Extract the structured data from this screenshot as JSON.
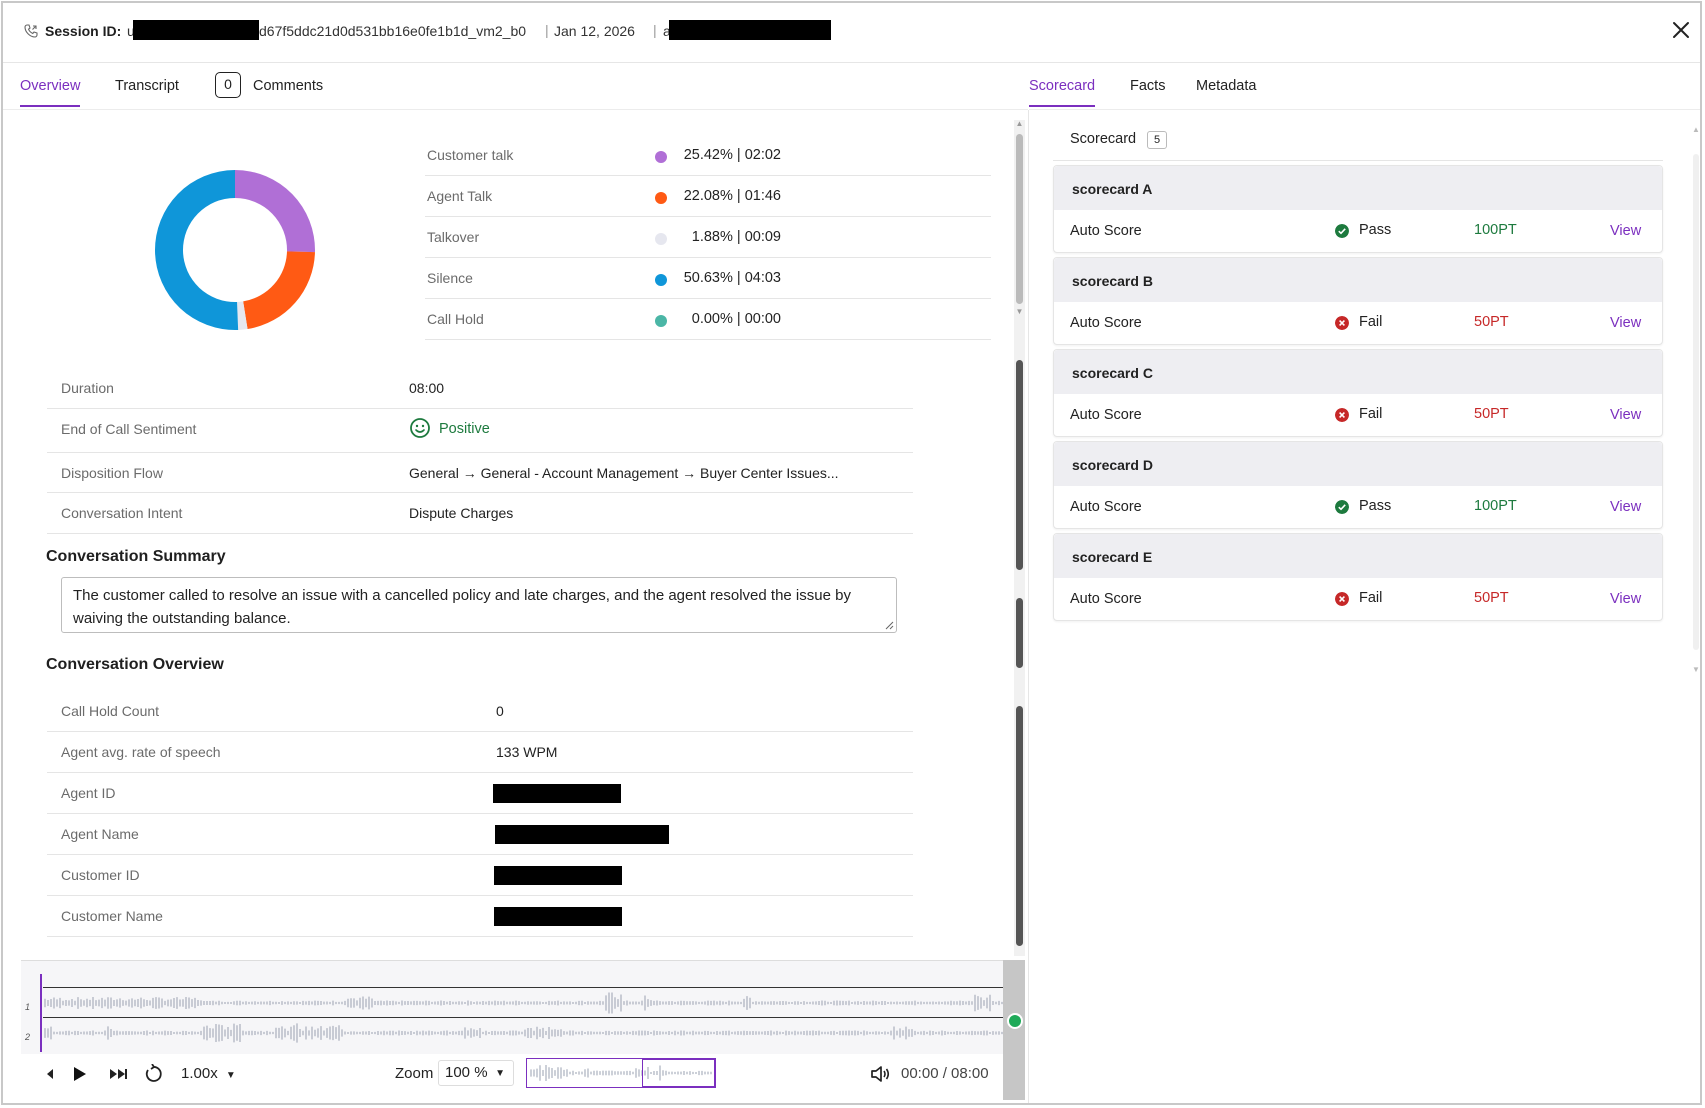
{
  "header": {
    "session_label": "Session ID:",
    "session_prefix": "u",
    "session_id_tail": "d67f5ddc21d0d531bb16e0fe1b1d_vm2_b0",
    "date": "Jan 12, 2026",
    "user_prefix": "a",
    "separator": "|"
  },
  "left_tabs": {
    "overview": "Overview",
    "transcript": "Transcript",
    "comments_count": "0",
    "comments": "Comments"
  },
  "right_tabs": {
    "scorecard": "Scorecard",
    "facts": "Facts",
    "metadata": "Metadata"
  },
  "talk_breakdown": {
    "items": [
      {
        "label": "Customer talk",
        "value": "25.42% | 02:02",
        "color": "#b06fd6",
        "percent": 25.42
      },
      {
        "label": "Agent Talk",
        "value": "22.08% | 01:46",
        "color": "#ff5a14",
        "percent": 22.08
      },
      {
        "label": "Talkover",
        "value": "1.88% | 00:09",
        "color": "#e6e7ef",
        "percent": 1.88
      },
      {
        "label": "Silence",
        "value": "50.63% | 04:03",
        "color": "#0f96d9",
        "percent": 50.63
      },
      {
        "label": "Call Hold",
        "value": "0.00% | 00:00",
        "color": "#4bb6a6",
        "percent": 0.0
      }
    ]
  },
  "call_info": {
    "duration_label": "Duration",
    "duration": "08:00",
    "sentiment_label": "End of Call Sentiment",
    "sentiment": "Positive",
    "disposition_label": "Disposition Flow",
    "disposition": "General → General - Account Management → Buyer Center Issues...",
    "intent_label": "Conversation Intent",
    "intent": "Dispute Charges"
  },
  "summary": {
    "title": "Conversation Summary",
    "text": "The customer called to resolve an issue with a cancelled policy and late charges, and the agent resolved the issue by waiving the outstanding balance."
  },
  "overview": {
    "title": "Conversation Overview",
    "hold_count_label": "Call Hold Count",
    "hold_count": "0",
    "rate_label": "Agent avg. rate of speech",
    "rate": "133 WPM",
    "agent_id_label": "Agent ID",
    "agent_name_label": "Agent Name",
    "customer_id_label": "Customer ID",
    "customer_name_label": "Customer Name"
  },
  "player": {
    "track1": "1",
    "track2": "2",
    "speed": "1.00x",
    "zoom_label": "Zoom",
    "zoom_value": "100 %",
    "time": "00:00 / 08:00"
  },
  "scorecard": {
    "title": "Scorecard",
    "count": "5",
    "cards": [
      {
        "title": "scorecard A",
        "type": "Auto Score",
        "status": "Pass",
        "points": "100PT",
        "view": "View"
      },
      {
        "title": "scorecard B",
        "type": "Auto Score",
        "status": "Fail",
        "points": "50PT",
        "view": "View"
      },
      {
        "title": "scorecard C",
        "type": "Auto Score",
        "status": "Fail",
        "points": "50PT",
        "view": "View"
      },
      {
        "title": "scorecard D",
        "type": "Auto Score",
        "status": "Pass",
        "points": "100PT",
        "view": "View"
      },
      {
        "title": "scorecard E",
        "type": "Auto Score",
        "status": "Fail",
        "points": "50PT",
        "view": "View"
      }
    ]
  },
  "colors": {
    "accent": "#7b2fbf",
    "pass": "#1d7a3e",
    "fail": "#c62828"
  }
}
